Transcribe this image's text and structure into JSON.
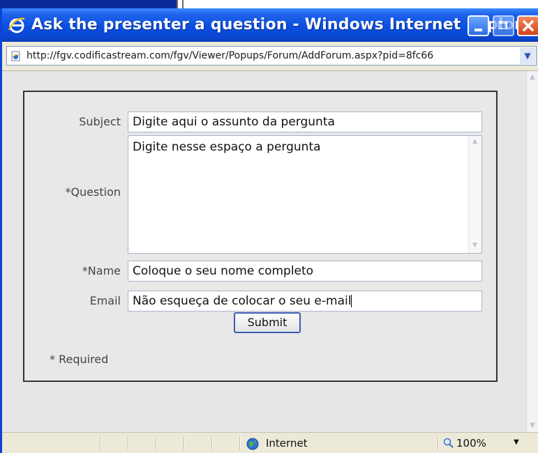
{
  "window": {
    "title": "Ask the presenter a question - Windows Internet Explorer"
  },
  "address_bar": {
    "url": "http://fgv.codificastream.com/fgv/Viewer/Popups/Forum/AddForum.aspx?pid=8fc66"
  },
  "form": {
    "subject_label": "Subject",
    "subject_value": "Digite aqui o assunto da pergunta",
    "question_label": "*Question",
    "question_value": "Digite nesse espaço a pergunta",
    "name_label": "*Name",
    "name_value": "Coloque o seu nome completo",
    "email_label": "Email",
    "email_value": "Não esqueça de colocar o seu e-mail",
    "submit_label": "Submit",
    "required_note": "* Required"
  },
  "status_bar": {
    "zone": "Internet",
    "zoom": "100%"
  },
  "colors": {
    "titlebar": "#0a4fe0",
    "close_button": "#d6421c",
    "panel_border": "#333333"
  },
  "icons": {
    "title": "ie-logo-icon",
    "page": "page-icon",
    "zone": "globe-icon",
    "zoom": "magnifier-icon"
  }
}
